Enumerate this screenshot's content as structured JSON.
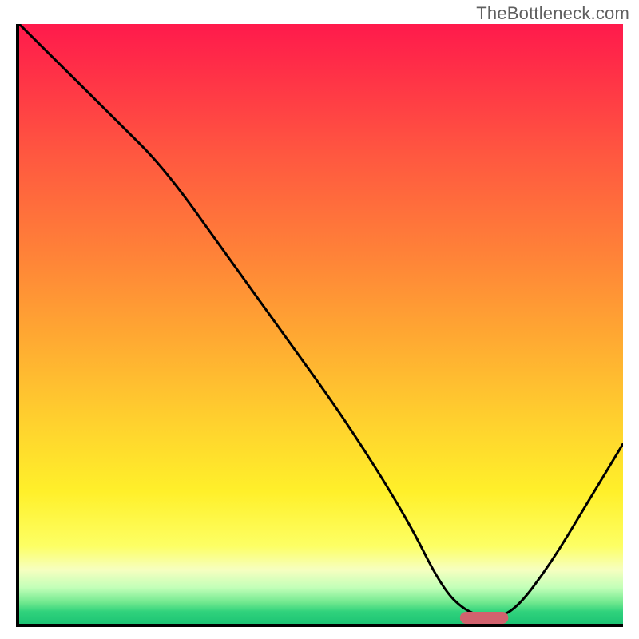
{
  "watermark": "TheBottleneck.com",
  "colors": {
    "axis": "#000000",
    "curve": "#000000",
    "marker": "#d1626e",
    "gradient_top": "#ff1a4c",
    "gradient_bottom": "#1dc474"
  },
  "chart_data": {
    "type": "line",
    "title": "",
    "xlabel": "",
    "ylabel": "",
    "xlim": [
      0,
      100
    ],
    "ylim": [
      0,
      100
    ],
    "grid": false,
    "legend": false,
    "description": "Single black curve over a vertical red-to-green heat gradient. Curve starts near top-left, descends steeply with a slight knee around x≈24, reaches a flat minimum around x≈72–80 at y≈0, then rises to about y≈30 at the right edge. A small salmon pill marks the minimum.",
    "series": [
      {
        "name": "curve",
        "x": [
          0,
          8,
          16,
          24,
          34,
          44,
          54,
          64,
          70,
          74,
          78,
          82,
          88,
          94,
          100
        ],
        "y": [
          100,
          92,
          84,
          76,
          62,
          48,
          34,
          18,
          6,
          2,
          1,
          2,
          10,
          20,
          30
        ]
      }
    ],
    "marker": {
      "x_center": 77,
      "y": 1,
      "width": 8,
      "height": 2
    },
    "background_gradient_stops": [
      {
        "pos": 0,
        "color": "#ff1a4c"
      },
      {
        "pos": 0.22,
        "color": "#ff5840"
      },
      {
        "pos": 0.52,
        "color": "#ffa832"
      },
      {
        "pos": 0.78,
        "color": "#fff02a"
      },
      {
        "pos": 0.91,
        "color": "#f6ffc0"
      },
      {
        "pos": 0.97,
        "color": "#30d27c"
      },
      {
        "pos": 1.0,
        "color": "#1dc474"
      }
    ]
  }
}
